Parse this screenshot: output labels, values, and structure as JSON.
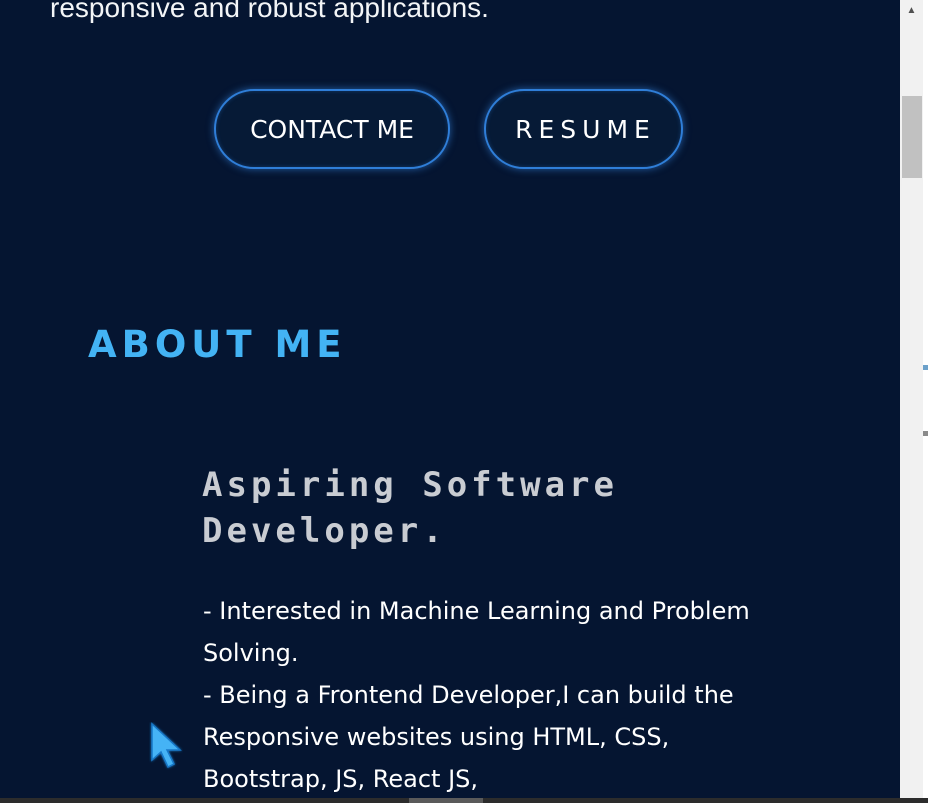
{
  "hero": {
    "intro_tail": "responsive and robust applications."
  },
  "buttons": {
    "contact_label": "CONTACT ME",
    "resume_label": "RESUME"
  },
  "about": {
    "section_title": "ABOUT ME",
    "heading": "Aspiring Software Developer.",
    "lines": [
      "- Interested in Machine Learning and Problem Solving.",
      "- Being a Frontend Developer,I can build the Responsive websites using HTML, CSS, Bootstrap, JS, React JS,"
    ]
  },
  "colors": {
    "background": "#051531",
    "accent": "#43b3f4",
    "button_border": "#2f7ed8",
    "heading_gray": "#c9ccd2"
  },
  "icons": {
    "cursor": "mouse-pointer-icon",
    "scroll_up": "scroll-up-arrow-icon"
  }
}
